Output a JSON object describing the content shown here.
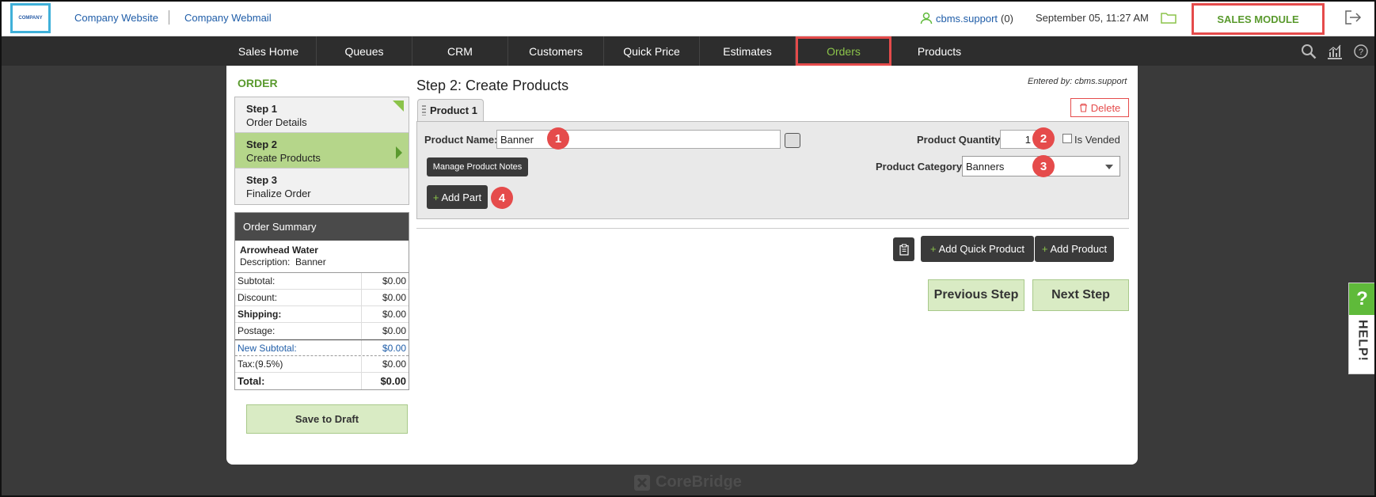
{
  "topbar": {
    "logo_text": "COMPANY",
    "company_website": "Company Website",
    "company_webmail": "Company Webmail",
    "user": "cbms.support",
    "user_count": "(0)",
    "datetime": "September 05, 11:27 AM",
    "sales_module": "SALES MODULE"
  },
  "nav": {
    "items": [
      "Sales Home",
      "Queues",
      "CRM",
      "Customers",
      "Quick Price",
      "Estimates",
      "Orders",
      "Products"
    ],
    "active": "Orders"
  },
  "sidebar": {
    "heading": "ORDER",
    "steps": [
      {
        "title": "Step 1",
        "label": "Order Details"
      },
      {
        "title": "Step 2",
        "label": "Create Products"
      },
      {
        "title": "Step 3",
        "label": "Finalize Order"
      }
    ]
  },
  "summary": {
    "heading": "Order Summary",
    "customer": "Arrowhead Water",
    "description_label": "Description:",
    "description": "Banner",
    "rows": [
      {
        "label": "Subtotal:",
        "value": "$0.00"
      },
      {
        "label": "Discount:",
        "value": "$0.00"
      },
      {
        "label": "Shipping:",
        "value": "$0.00"
      },
      {
        "label": "Postage:",
        "value": "$0.00"
      },
      {
        "label": "New Subtotal:",
        "value": "$0.00"
      },
      {
        "label": "Tax:(9.5%)",
        "value": "$0.00"
      },
      {
        "label": "Total:",
        "value": "$0.00"
      }
    ],
    "save_draft": "Save to Draft"
  },
  "main": {
    "title": "Step 2: Create Products",
    "entered_by": "Entered by: cbms.support",
    "tab": "Product 1",
    "delete": "Delete",
    "product_name_label": "Product Name:",
    "product_name_value": "Banner",
    "product_quantity_label": "Product Quantity:",
    "product_quantity_value": "1",
    "is_vended_label": "Is Vended",
    "manage_notes": "Manage Product Notes",
    "product_category_label": "Product Category:",
    "product_category_value": "Banners",
    "add_part": "Add Part",
    "add_quick_product": "Add Quick Product",
    "add_product": "Add Product",
    "previous_step": "Previous Step",
    "next_step": "Next Step",
    "badges": [
      "1",
      "2",
      "3",
      "4"
    ]
  },
  "help": {
    "q": "?",
    "label": "HELP!"
  },
  "footer": {
    "brand": "CoreBridge"
  },
  "colors": {
    "accent_green": "#8bc34a",
    "highlight_red": "#e54b4b",
    "link_blue": "#1f5da8"
  }
}
